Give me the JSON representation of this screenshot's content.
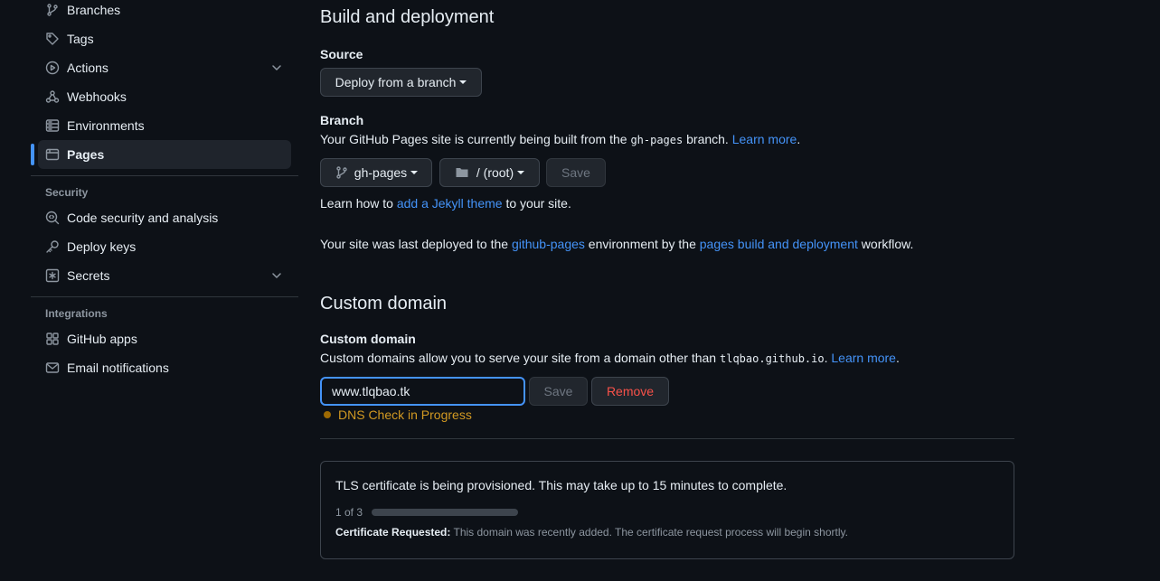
{
  "sidebar": {
    "items_top": [
      {
        "label": "Branches",
        "icon": "branch-icon"
      },
      {
        "label": "Tags",
        "icon": "tag-icon"
      },
      {
        "label": "Actions",
        "icon": "play-icon",
        "expandable": true
      },
      {
        "label": "Webhooks",
        "icon": "webhook-icon"
      },
      {
        "label": "Environments",
        "icon": "server-icon"
      },
      {
        "label": "Pages",
        "icon": "browser-icon",
        "active": true
      }
    ],
    "security_heading": "Security",
    "security_items": [
      {
        "label": "Code security and analysis",
        "icon": "codescan-icon"
      },
      {
        "label": "Deploy keys",
        "icon": "key-icon"
      },
      {
        "label": "Secrets",
        "icon": "asterisk-icon",
        "expandable": true
      }
    ],
    "integrations_heading": "Integrations",
    "integrations_items": [
      {
        "label": "GitHub apps",
        "icon": "apps-icon"
      },
      {
        "label": "Email notifications",
        "icon": "mail-icon"
      }
    ]
  },
  "build": {
    "title": "Build and deployment",
    "source_label": "Source",
    "source_value": "Deploy from a branch",
    "branch_label": "Branch",
    "branch_note_prefix": "Your GitHub Pages site is currently being built from the",
    "branch_note_code": "gh-pages",
    "branch_note_suffix": "branch.",
    "learn_more": "Learn more",
    "branch_select": "gh-pages",
    "folder_select": "/ (root)",
    "save_label": "Save",
    "jekyll_prefix": "Learn how to",
    "jekyll_link": "add a Jekyll theme",
    "jekyll_suffix": "to your site.",
    "deployed_prefix": "Your site was last deployed to the",
    "deployed_env_link": "github-pages",
    "deployed_mid": "environment by the",
    "deployed_workflow_link": "pages build and deployment",
    "deployed_suffix": "workflow."
  },
  "custom_domain": {
    "title": "Custom domain",
    "label": "Custom domain",
    "note_prefix": "Custom domains allow you to serve your site from a domain other than",
    "note_code": "tlqbao.github.io",
    "note_suffix": ".",
    "learn_more": "Learn more",
    "input_value": "www.tlqbao.tk",
    "save_label": "Save",
    "remove_label": "Remove",
    "dns_status": "DNS Check in Progress"
  },
  "tls": {
    "message": "TLS certificate is being provisioned. This may take up to 15 minutes to complete.",
    "step_text": "1 of 3",
    "step_progress": 0.0,
    "requested_label": "Certificate Requested:",
    "requested_text": "This domain was recently added. The certificate request process will begin shortly."
  },
  "colors": {
    "accent": "#4493f8",
    "warning": "#d29922",
    "danger": "#f85149",
    "background": "#0d1117"
  }
}
